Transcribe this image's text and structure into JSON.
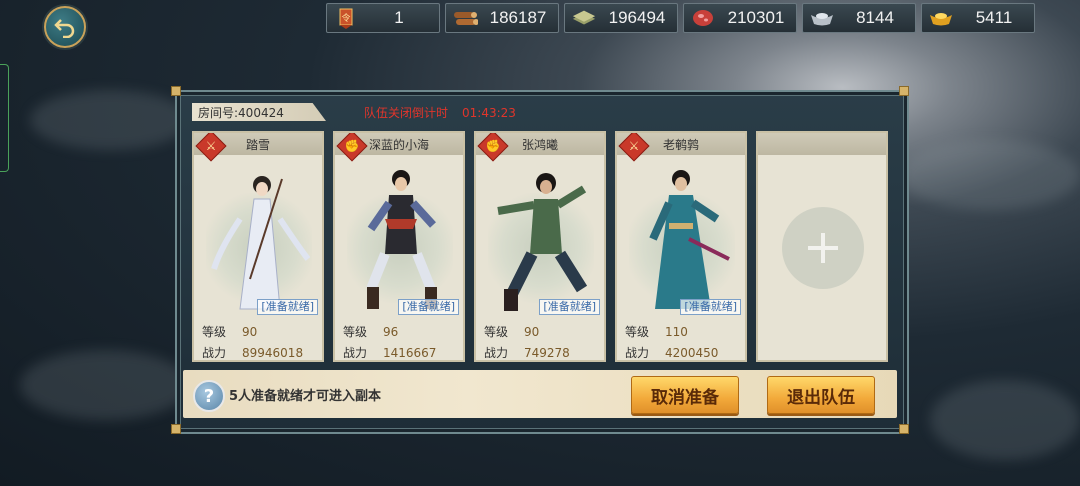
{
  "header": {
    "resources": [
      {
        "name": "token",
        "icon": "banner-scroll-icon",
        "value": "1"
      },
      {
        "name": "wood",
        "icon": "wood-log-icon",
        "value": "186187"
      },
      {
        "name": "stone",
        "icon": "stone-slab-icon",
        "value": "196494"
      },
      {
        "name": "meat",
        "icon": "meat-icon",
        "value": "210301"
      },
      {
        "name": "silver",
        "icon": "silver-ingot-icon",
        "value": "8144"
      },
      {
        "name": "gold",
        "icon": "gold-ingot-icon",
        "value": "5411"
      }
    ]
  },
  "room": {
    "label": "房间号:400424",
    "countdown_label": "队伍关闭倒计时",
    "countdown_time": "01:43:23"
  },
  "members": [
    {
      "name": "踏雪",
      "ready": "[准备就绪]",
      "level_label": "等级",
      "level": "90",
      "power_label": "战力",
      "power": "89946018",
      "class_icon": "sword-icon"
    },
    {
      "name": "深蓝的小海",
      "ready": "[准备就绪]",
      "level_label": "等级",
      "level": "96",
      "power_label": "战力",
      "power": "1416667",
      "class_icon": "fist-icon"
    },
    {
      "name": "张鸿曦",
      "ready": "[准备就绪]",
      "level_label": "等级",
      "level": "90",
      "power_label": "战力",
      "power": "749278",
      "class_icon": "fist-icon"
    },
    {
      "name": "老鹌鹑",
      "ready": "[准备就绪]",
      "level_label": "等级",
      "level": "110",
      "power_label": "战力",
      "power": "4200450",
      "class_icon": "sword-icon"
    }
  ],
  "footer": {
    "hint": "5人准备就绪才可进入副本",
    "cancel_label": "取消准备",
    "exit_label": "退出队伍"
  },
  "colors": {
    "accent_gold": "#f2a93a",
    "countdown_red": "#e0352b",
    "badge_red": "#c9392a"
  }
}
